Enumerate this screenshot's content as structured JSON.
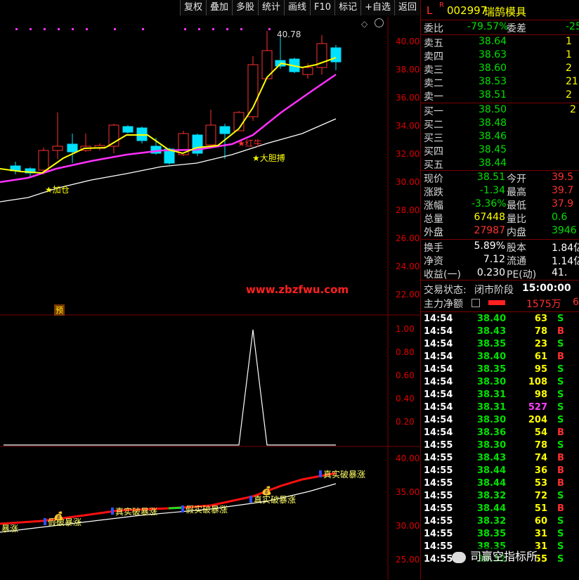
{
  "toolbar": {
    "buttons": [
      "复权",
      "叠加",
      "多股",
      "统计",
      "画线",
      "F10",
      "标记",
      "+自选",
      "返回"
    ]
  },
  "header": {
    "market_flag": "L",
    "r_flag": "R",
    "code": "002997",
    "name": "瑞鹄模具"
  },
  "order_ratio": {
    "label1": "委比",
    "value1": "-79.57%",
    "label2": "委差",
    "value2": "-25"
  },
  "sell": [
    {
      "label": "卖五",
      "price": "38.64",
      "vol": "1"
    },
    {
      "label": "卖四",
      "price": "38.63",
      "vol": "1"
    },
    {
      "label": "卖三",
      "price": "38.60",
      "vol": "2"
    },
    {
      "label": "卖二",
      "price": "38.53",
      "vol": "21"
    },
    {
      "label": "卖一",
      "price": "38.51",
      "vol": "2"
    }
  ],
  "buy": [
    {
      "label": "买一",
      "price": "38.50",
      "vol": "2"
    },
    {
      "label": "买二",
      "price": "38.48",
      "vol": ""
    },
    {
      "label": "买三",
      "price": "38.46",
      "vol": ""
    },
    {
      "label": "买四",
      "price": "38.45",
      "vol": ""
    },
    {
      "label": "买五",
      "price": "38.44",
      "vol": ""
    }
  ],
  "quote": [
    {
      "l1": "现价",
      "v1": "38.51",
      "l2": "今开",
      "v2": "39.5"
    },
    {
      "l1": "涨跌",
      "v1": "-1.34",
      "l2": "最高",
      "v2": "39.7"
    },
    {
      "l1": "涨幅",
      "v1": "-3.36%",
      "l2": "最低",
      "v2": "37.9"
    },
    {
      "l1": "总量",
      "v1": "67448",
      "l2": "量比",
      "v2": "0.6"
    },
    {
      "l1": "外盘",
      "v1": "27987",
      "l2": "内盘",
      "v2": "3946"
    }
  ],
  "fund": [
    {
      "l1": "换手",
      "v1": "5.89%",
      "l2": "股本",
      "v2": "1.84亿"
    },
    {
      "l1": "净资",
      "v1": "7.12",
      "l2": "流通",
      "v2": "1.14亿"
    },
    {
      "l1": "收益(一)",
      "v1": "0.230",
      "l2": "PE(动)",
      "v2": "41."
    }
  ],
  "trade_status": {
    "label": "交易状态:",
    "value": "闭市阶段",
    "time": "15:00:00"
  },
  "main_flow": {
    "label": "主力净额",
    "value": "1575万",
    "extra": "6"
  },
  "ticks": [
    {
      "t": "14:54",
      "p": "38.40",
      "v": "63",
      "d": "S"
    },
    {
      "t": "14:54",
      "p": "38.43",
      "v": "78",
      "d": "B"
    },
    {
      "t": "14:54",
      "p": "38.35",
      "v": "23",
      "d": "S"
    },
    {
      "t": "14:54",
      "p": "38.40",
      "v": "61",
      "d": "B"
    },
    {
      "t": "14:54",
      "p": "38.35",
      "v": "95",
      "d": "S"
    },
    {
      "t": "14:54",
      "p": "38.30",
      "v": "108",
      "d": "S"
    },
    {
      "t": "14:54",
      "p": "38.31",
      "v": "98",
      "d": "S"
    },
    {
      "t": "14:54",
      "p": "38.31",
      "v": "527",
      "d": "S"
    },
    {
      "t": "14:54",
      "p": "38.30",
      "v": "204",
      "d": "S"
    },
    {
      "t": "14:54",
      "p": "38.36",
      "v": "54",
      "d": "B"
    },
    {
      "t": "14:55",
      "p": "38.30",
      "v": "78",
      "d": "S"
    },
    {
      "t": "14:55",
      "p": "38.43",
      "v": "74",
      "d": "B"
    },
    {
      "t": "14:55",
      "p": "38.44",
      "v": "36",
      "d": "B"
    },
    {
      "t": "14:55",
      "p": "38.44",
      "v": "53",
      "d": "B"
    },
    {
      "t": "14:55",
      "p": "38.32",
      "v": "72",
      "d": "S"
    },
    {
      "t": "14:55",
      "p": "38.44",
      "v": "51",
      "d": "B"
    },
    {
      "t": "14:55",
      "p": "38.32",
      "v": "60",
      "d": "S"
    },
    {
      "t": "14:55",
      "p": "38.35",
      "v": "31",
      "d": "S"
    },
    {
      "t": "14:55",
      "p": "38.35",
      "v": "31",
      "d": "S"
    },
    {
      "t": "14:55",
      "p": "38.32",
      "v": "55",
      "d": "S"
    }
  ],
  "chart": {
    "price_axis": [
      "40.00",
      "38.00",
      "36.00",
      "34.00",
      "32.00",
      "30.00",
      "28.00",
      "26.00",
      "24.00",
      "22.00"
    ],
    "max_label": "40.78",
    "annotations": [
      "加仓",
      "红牛",
      "大胆搏",
      "预"
    ],
    "watermark": "www.zbzfwu.com",
    "ind1_axis": [
      "1.00",
      "0.80",
      "0.60",
      "0.40",
      "0.20"
    ],
    "ind2_axis": [
      "40.00",
      "35.00",
      "30.00",
      "25.00"
    ],
    "ind2_labels": [
      "真实破暴涨",
      "真实破暴涨",
      "假破暴涨",
      "假实破暴涨",
      "真实破暴涨",
      "暴涨"
    ],
    "brand": "司赢空指标所"
  },
  "colors": {
    "up": "#ff3030",
    "down": "#00e0ff",
    "ma_yellow": "#ffff00",
    "ma_magenta": "#ff30ff",
    "ma_white": "#ffffff",
    "grid": "#7a0000"
  }
}
